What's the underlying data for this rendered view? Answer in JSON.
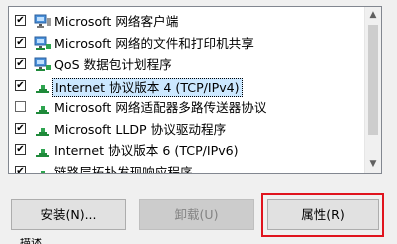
{
  "components": [
    {
      "label": "Microsoft 网络客户端",
      "checked": true,
      "icon": "network-client-icon"
    },
    {
      "label": "Microsoft 网络的文件和打印机共享",
      "checked": true,
      "icon": "network-service-icon"
    },
    {
      "label": "QoS 数据包计划程序",
      "checked": true,
      "icon": "network-service-icon"
    },
    {
      "label": "Internet 协议版本 4 (TCP/IPv4)",
      "checked": true,
      "icon": "protocol-icon",
      "selected": true
    },
    {
      "label": "Microsoft 网络适配器多路传送器协议",
      "checked": false,
      "icon": "protocol-icon"
    },
    {
      "label": "Microsoft LLDP 协议驱动程序",
      "checked": true,
      "icon": "protocol-icon"
    },
    {
      "label": "Internet 协议版本 6 (TCP/IPv6)",
      "checked": true,
      "icon": "protocol-icon"
    },
    {
      "label": "链路层拓扑发现响应程序",
      "checked": true,
      "icon": "protocol-icon"
    }
  ],
  "buttons": {
    "install": "安装(N)...",
    "uninstall": "卸载(U)",
    "properties": "属性(R)"
  },
  "description_label": "描述",
  "colors": {
    "highlight": "#e0141e",
    "selection": "#cce8ff",
    "protocol_icon": "#1f8a3a"
  }
}
